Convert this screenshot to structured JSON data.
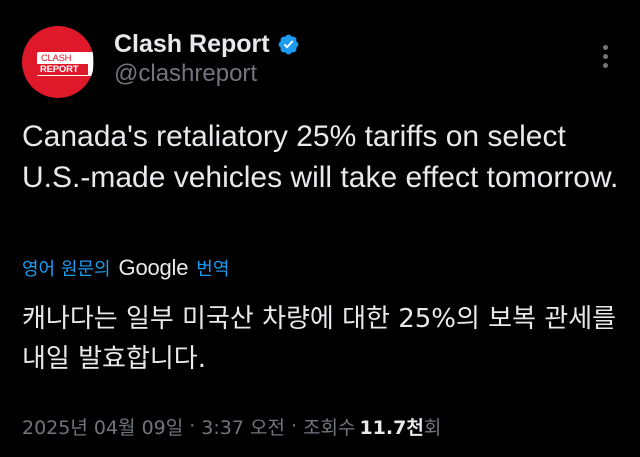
{
  "author": {
    "avatar_text_top": "CLASH",
    "avatar_text_bottom": "REPORT",
    "display_name": "Clash Report",
    "handle": "@clashreport",
    "verified_icon": "verified-badge-icon",
    "verified_color": "#1d9bf0",
    "avatar_color": "#e0192a"
  },
  "tweet": {
    "text": "Canada's retaliatory 25% tariffs on select U.S.-made vehicles will take effect tomorrow."
  },
  "translation": {
    "prefix": "영어 원문의",
    "provider": "Google",
    "suffix": "번역",
    "text": "캐나다는 일부 미국산 차량에 대한 25%의 보복 관세를 내일 발효합니다."
  },
  "meta": {
    "date": "2025년 04월 09일",
    "separator": "·",
    "time": "3:37 오전",
    "views_label": "조회수",
    "views_count": "11.7천",
    "views_suffix": "회"
  },
  "colors": {
    "background": "#000000",
    "text": "#e7e9ea",
    "secondary": "#71767b",
    "link": "#1d9bf0"
  }
}
